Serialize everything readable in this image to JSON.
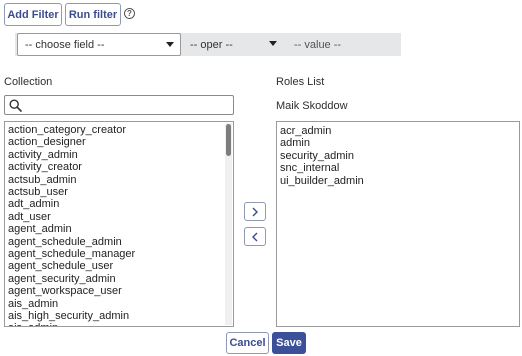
{
  "toolbar": {
    "add_filter_label": "Add Filter",
    "run_filter_label": "Run filter",
    "help_glyph": "?"
  },
  "filter": {
    "field_placeholder": "-- choose field --",
    "oper_placeholder": "-- oper --",
    "value_placeholder": "-- value --"
  },
  "collection": {
    "label": "Collection",
    "search_value": "",
    "items": [
      "action_category_creator",
      "action_designer",
      "activity_admin",
      "activity_creator",
      "actsub_admin",
      "actsub_user",
      "adt_admin",
      "adt_user",
      "agent_admin",
      "agent_schedule_admin",
      "agent_schedule_manager",
      "agent_schedule_user",
      "agent_security_admin",
      "agent_workspace_user",
      "ais_admin",
      "ais_high_security_admin",
      "ais_admin"
    ]
  },
  "roles": {
    "label": "Roles List",
    "user_name": "Maik Skoddow",
    "items": [
      "acr_admin",
      "admin",
      "security_admin",
      "snc_internal",
      "ui_builder_admin"
    ]
  },
  "footer": {
    "cancel_label": "Cancel",
    "save_label": "Save"
  },
  "colors": {
    "accent": "#3c4f99",
    "button_text": "#3b4d8f",
    "filter_bar": "#e6e7e9"
  },
  "icons": {
    "search": "search-icon",
    "move_right": "chevron-right-icon",
    "move_left": "chevron-left-icon",
    "dropdown": "caret-down-icon",
    "help": "help-circle-icon"
  }
}
